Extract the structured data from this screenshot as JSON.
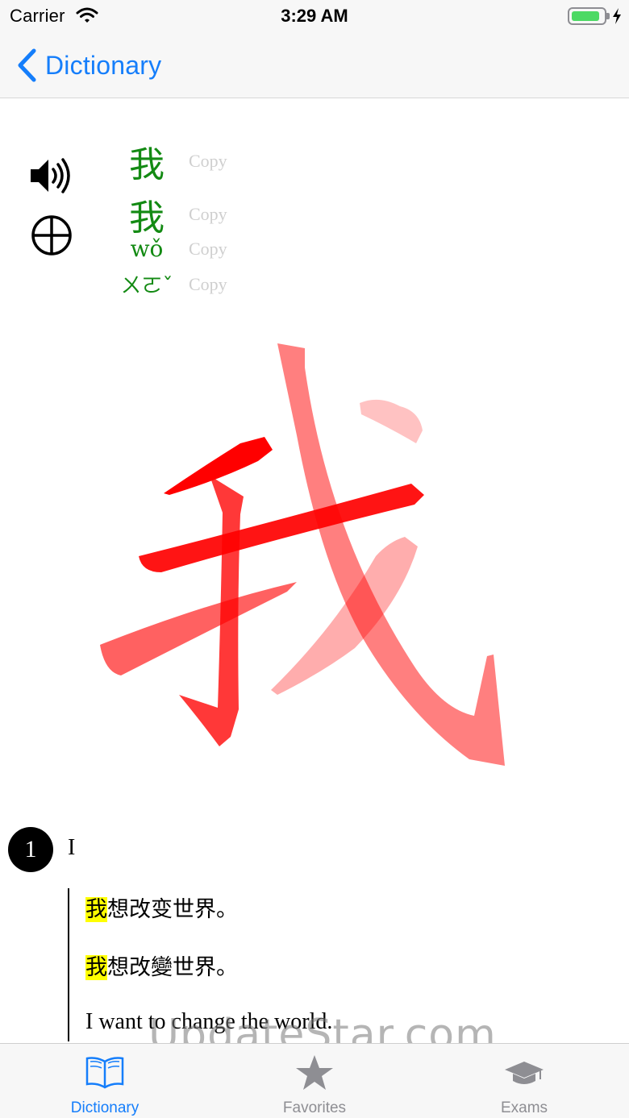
{
  "status_bar": {
    "carrier": "Carrier",
    "time": "3:29 AM",
    "battery_level": 0.85,
    "battery_color": "#4cd964"
  },
  "nav": {
    "back_label": "Dictionary",
    "back_icon": "chevron-left-icon",
    "tint": "#157efb"
  },
  "entry": {
    "simplified": "我",
    "traditional": "我",
    "pinyin": "wǒ",
    "zhuyin": "ㄨㄛˇ",
    "copy_label": "Copy",
    "form_color": "#138a13",
    "big_character": "我",
    "stroke_color": "#ff0000"
  },
  "definitions": [
    {
      "number": "1",
      "text": "I",
      "example": {
        "simplified_highlight": "我",
        "simplified_rest": "想改变世界。",
        "traditional_highlight": "我",
        "traditional_rest": "想改變世界。",
        "english": "I want to change the world."
      }
    }
  ],
  "watermark": "UpdateStar.com",
  "tab_bar": {
    "active_color": "#157efb",
    "inactive_color": "#8e8e93",
    "tabs": [
      {
        "label": "Dictionary",
        "icon": "book-icon",
        "active": true
      },
      {
        "label": "Favorites",
        "icon": "star-icon",
        "active": false
      },
      {
        "label": "Exams",
        "icon": "graduation-cap-icon",
        "active": false
      }
    ]
  }
}
